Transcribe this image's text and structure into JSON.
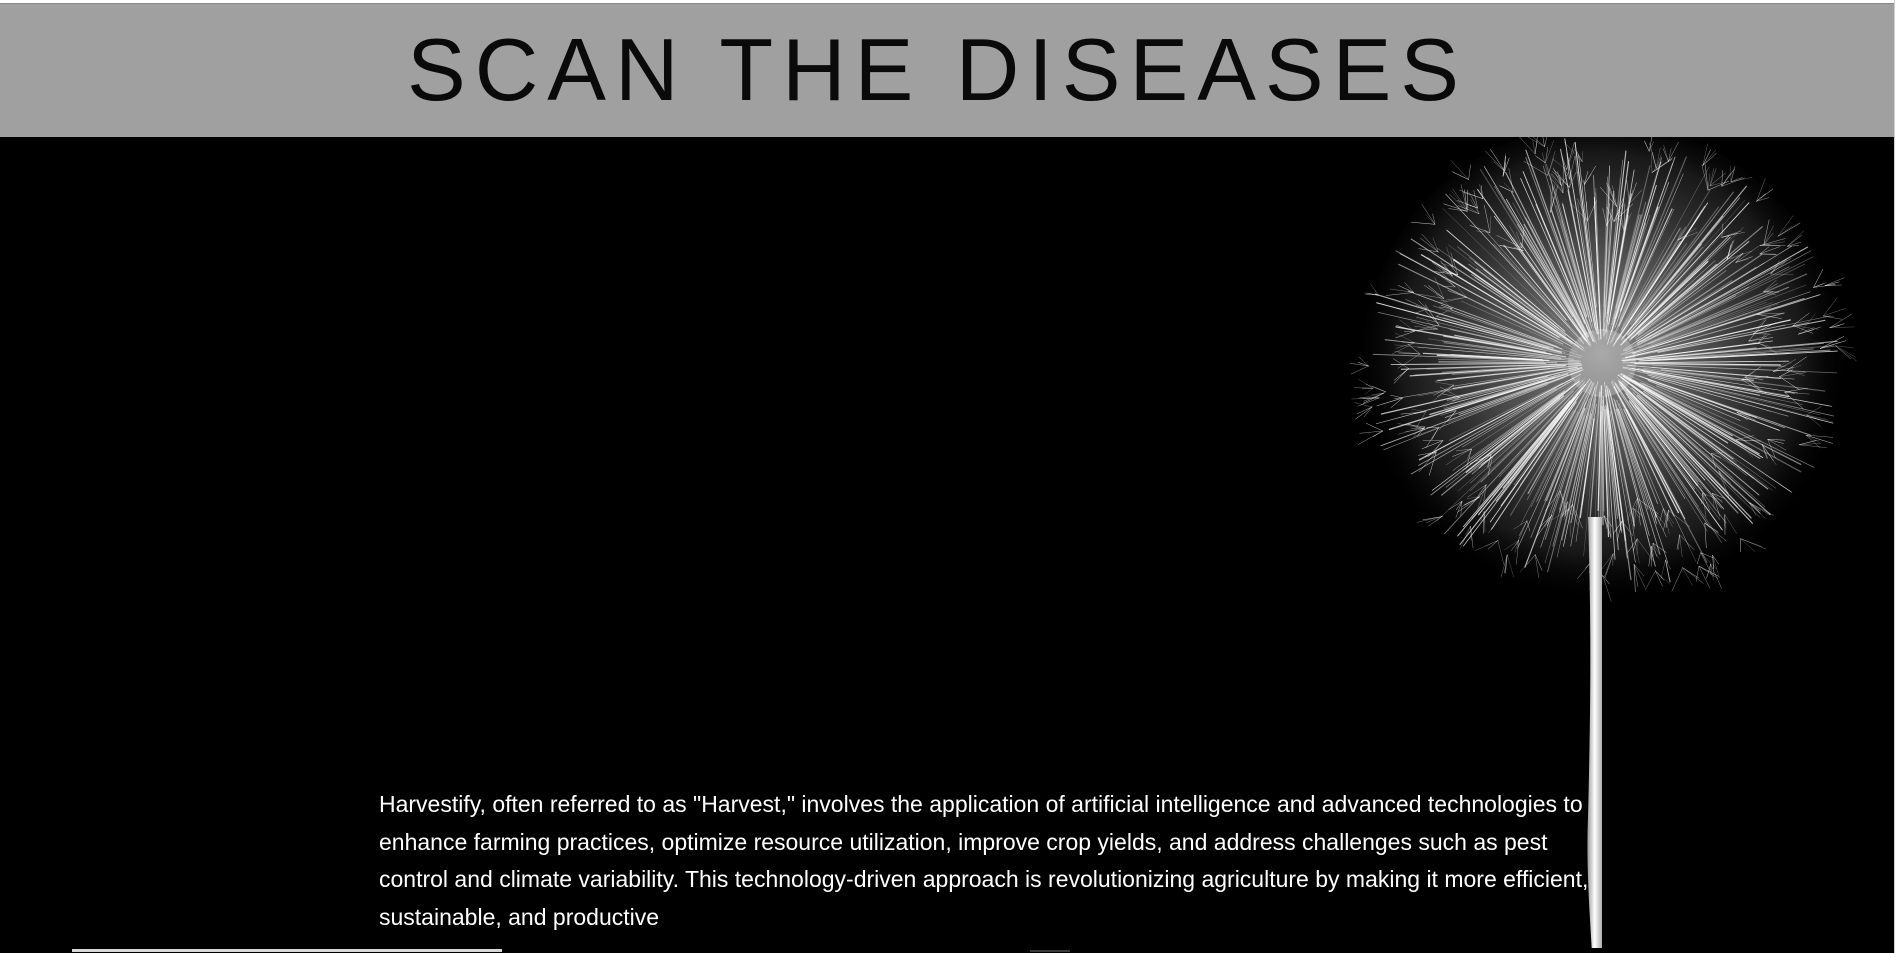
{
  "header": {
    "title": "SCAN THE DISEASES"
  },
  "hero": {
    "image_icon": "dandelion-image",
    "description": "Harvestify, often referred to as \"Harvest,\" involves the application of artificial intelligence and advanced technologies to enhance farming practices, optimize resource utilization, improve crop yields, and address challenges such as pest control and climate variability. This technology-driven approach is revolutionizing agriculture by making it more efficient, sustainable, and productive"
  },
  "colors": {
    "header_bg": "#a0a0a0",
    "hero_bg": "#000000",
    "title_text": "#0a0a0a",
    "body_text": "#ffffff"
  }
}
